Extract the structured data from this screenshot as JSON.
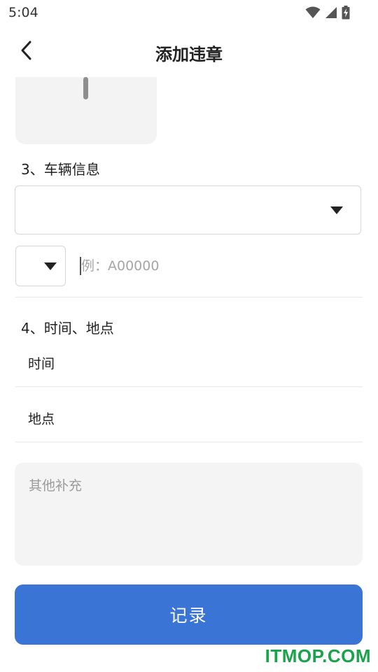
{
  "status_bar": {
    "time": "5:04",
    "icons": [
      "wifi-icon",
      "signal-icon",
      "battery-charging-icon"
    ]
  },
  "app_bar": {
    "title": "添加违章",
    "back_icon": "chevron-left-icon"
  },
  "sections": {
    "vehicle": {
      "title": "3、车辆信息",
      "select_value": "",
      "prefix_value": "",
      "plate_placeholder": "例：A00000",
      "plate_value": ""
    },
    "time_place": {
      "title": "4、时间、地点",
      "time_label": "时间",
      "place_label": "地点"
    }
  },
  "remark": {
    "placeholder": "其他补充",
    "value": ""
  },
  "submit": {
    "label": "记录"
  },
  "watermark": "ITMOP.COM",
  "colors": {
    "primary": "#3a74d4",
    "watermark": "#1aa34a"
  }
}
